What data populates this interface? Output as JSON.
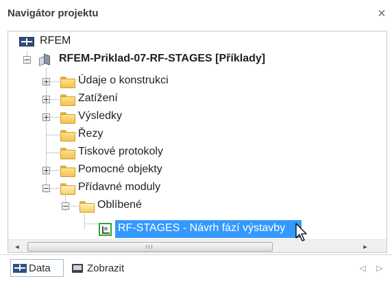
{
  "panel": {
    "title": "Navigátor projektu",
    "close_glyph": "×"
  },
  "tree": {
    "root": {
      "label": "RFEM",
      "icon": "rfem-icon"
    },
    "model": {
      "label": "RFEM-Priklad-07-RF-STAGES [Příklady]",
      "icon": "model-icon"
    },
    "items": [
      {
        "label": "Údaje o konstrukci",
        "icon": "folder-icon",
        "expander": "+"
      },
      {
        "label": "Zatížení",
        "icon": "folder-icon",
        "expander": "+"
      },
      {
        "label": "Výsledky",
        "icon": "folder-icon",
        "expander": "+"
      },
      {
        "label": "Řezy",
        "icon": "folder-icon",
        "expander": ""
      },
      {
        "label": "Tiskové protokoly",
        "icon": "folder-icon",
        "expander": ""
      },
      {
        "label": "Pomocné objekty",
        "icon": "folder-icon",
        "expander": "+"
      },
      {
        "label": "Přídavné moduly",
        "icon": "folder-open-icon",
        "expander": "-"
      }
    ],
    "favorites": {
      "label": "Oblíbené",
      "icon": "folder-open-icon",
      "expander": "-"
    },
    "selected": {
      "label": "RF-STAGES - Návrh fází výstavby",
      "icon": "stage-module-icon"
    }
  },
  "scrollbars": {
    "up_arrow": "▲",
    "down_arrow": "▼",
    "left_arrow": "◄",
    "right_arrow": "►",
    "h_grip": "III"
  },
  "tabs": [
    {
      "label": "Data",
      "icon": "data-icon",
      "active": true
    },
    {
      "label": "Zobrazit",
      "icon": "display-icon",
      "active": false
    }
  ],
  "tab_nav": {
    "prev": "◁",
    "next": "▷"
  }
}
